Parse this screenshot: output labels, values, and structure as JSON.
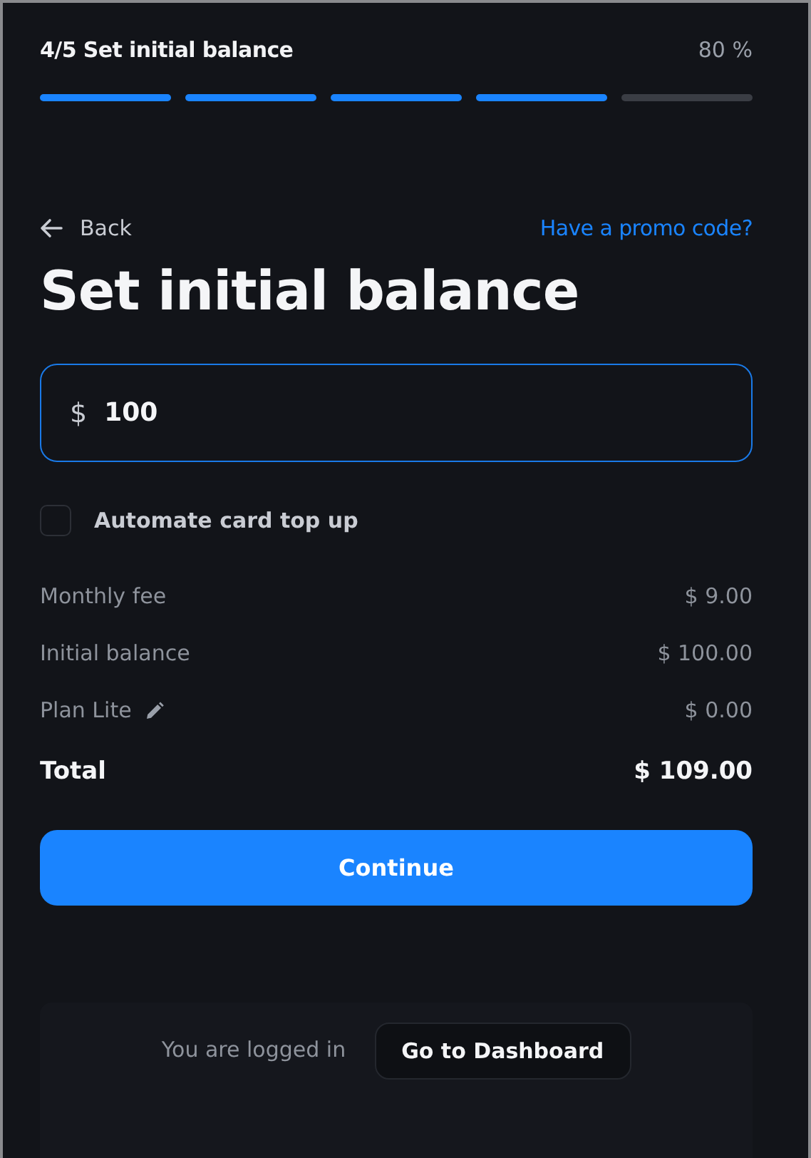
{
  "progress": {
    "step_label": "4/5 Set initial balance",
    "percent": "80 %",
    "segments": [
      {
        "done": true
      },
      {
        "done": true
      },
      {
        "done": true
      },
      {
        "done": true
      },
      {
        "done": false
      }
    ]
  },
  "back": "Back",
  "promo_link": "Have a promo code?",
  "title": "Set initial balance",
  "amount_field": {
    "prefix": "$",
    "value": "100"
  },
  "auto_top_up": {
    "label": "Automate card top up",
    "checked": false
  },
  "summary": [
    {
      "kind": "plain",
      "label": "Monthly fee",
      "value": "$ 9.00"
    },
    {
      "kind": "plain",
      "label": "Initial balance",
      "value": "$ 100.00"
    },
    {
      "kind": "editable",
      "label": "Plan Lite",
      "value": "$ 0.00"
    },
    {
      "kind": "total",
      "label": "Total",
      "value": "$ 109.00"
    }
  ],
  "continue_button": "Continue",
  "login_bar": {
    "text": "You are logged in",
    "button": "Go to Dashboard"
  }
}
